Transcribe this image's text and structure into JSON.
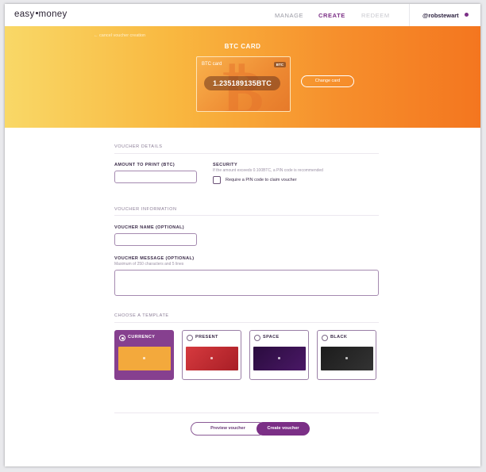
{
  "header": {
    "logo_left": "easy",
    "logo_right": "money",
    "nav": [
      "MANAGE",
      "CREATE",
      "REDEEM"
    ],
    "active_nav": "CREATE",
    "user": "@robstewart"
  },
  "hero": {
    "back_link": "← cancel voucher creation",
    "title": "BTC CARD",
    "card_label": "BTC card",
    "card_badge": "BTC",
    "card_amount": "1.235189135BTC",
    "change_button": "Change card"
  },
  "voucher_details": {
    "section": "VOUCHER DETAILS",
    "amount_label": "AMOUNT TO PRINT (BTC)",
    "amount_value": "",
    "security_label": "SECURITY",
    "security_hint": "If the amount exceeds 0.100BTC, a PIN code is recommended",
    "pin_checkbox_label": "Require a PIN code to claim voucher",
    "pin_checked": false
  },
  "voucher_information": {
    "section": "VOUCHER INFORMATION",
    "name_label": "VOUCHER NAME (OPTIONAL)",
    "name_value": "",
    "message_label": "VOUCHER MESSAGE (OPTIONAL)",
    "message_hint": "Maximum of 250 characters and 5 lines",
    "message_value": ""
  },
  "templates": {
    "section": "CHOOSE A TEMPLATE",
    "items": [
      {
        "name": "CURRENCY",
        "selected": true,
        "color": "#f3a93c"
      },
      {
        "name": "PRESENT",
        "selected": false,
        "color": "#c0282e"
      },
      {
        "name": "SPACE",
        "selected": false,
        "color": "#3a1150"
      },
      {
        "name": "BLACK",
        "selected": false,
        "color": "#242424"
      }
    ]
  },
  "actions": {
    "preview": "Preview voucher",
    "create": "Create voucher"
  },
  "colors": {
    "accent": "#7b2f86",
    "hero_start": "#f9d867",
    "hero_end": "#f4761f"
  }
}
